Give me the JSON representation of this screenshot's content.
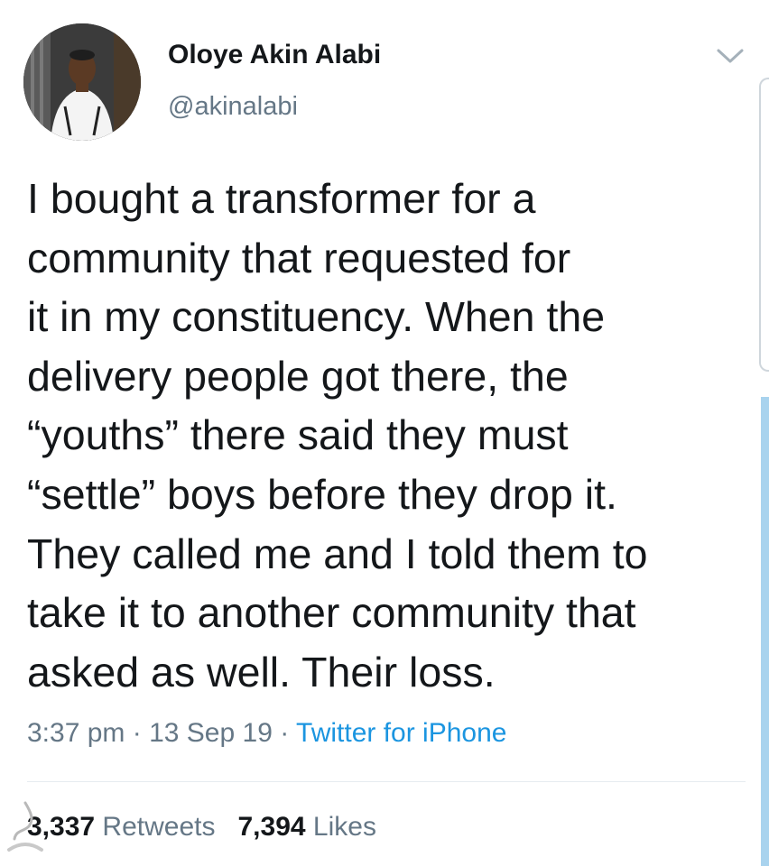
{
  "user": {
    "display_name": "Oloye Akin Alabi",
    "handle": "@akinalabi",
    "avatar_icon": "profile-photo"
  },
  "tweet": {
    "lines": [
      "I bought a transformer for a",
      "community that requested for",
      "it in my constituency. When the",
      "delivery people got there, the",
      "“youths” there said they must",
      "“settle” boys before they drop it.",
      "They called me and I told them to",
      "take it to another community that",
      "asked as well. Their loss."
    ]
  },
  "meta": {
    "time": "3:37 pm",
    "separator": "·",
    "date": "13 Sep 19",
    "source": "Twitter for iPhone"
  },
  "stats": {
    "retweets_count": "3,337",
    "retweets_label": "Retweets",
    "likes_count": "7,394",
    "likes_label": "Likes"
  },
  "colors": {
    "text": "#14171a",
    "secondary": "#657786",
    "link": "#1b95e0",
    "divider": "#e6ecf0",
    "side_bar": "#a9d3ee"
  }
}
